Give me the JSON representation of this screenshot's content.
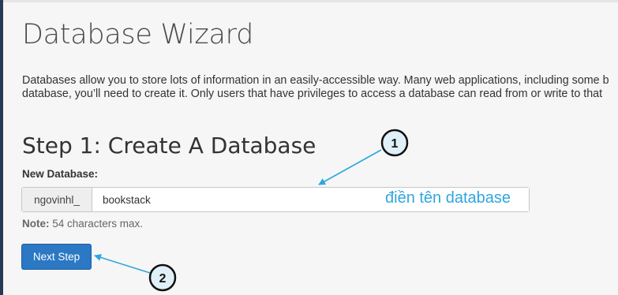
{
  "page": {
    "title": "Database Wizard",
    "description_lines": [
      "Databases allow you to store lots of information in an easily-accessible way. Many web applications, including some b",
      "database, you’ll need to create it. Only users that have privileges to access a database can read from or write to that"
    ]
  },
  "step": {
    "heading": "Step 1: Create A Database",
    "field_label": "New Database:",
    "prefix": "ngovinhl_",
    "value": "bookstack",
    "note_label": "Note:",
    "note_text": " 54 characters max.",
    "next_label": "Next Step"
  },
  "annotations": {
    "hint_text": "điền tên database",
    "badge1": "1",
    "badge2": "2",
    "colors": {
      "arrow": "#2fa6de",
      "hint": "#2fa6de",
      "badge_fill": "#e0f0f8"
    }
  }
}
